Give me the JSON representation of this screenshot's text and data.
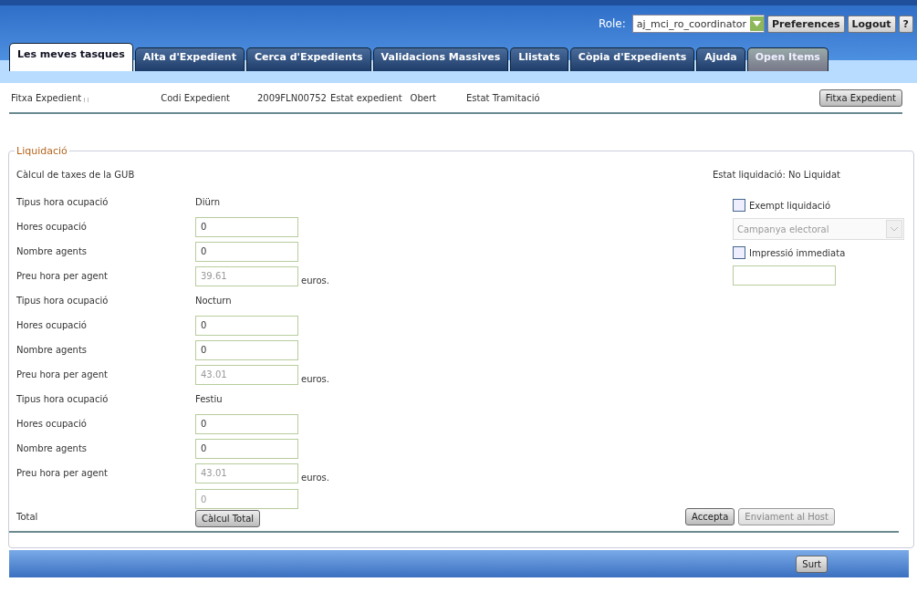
{
  "header": {
    "role_label": "Role:",
    "role_value": "aj_mci_ro_coordinator",
    "buttons": [
      "Preferences",
      "Logout",
      "?"
    ]
  },
  "tabs": [
    {
      "label": "Les meves tasques",
      "selected": true,
      "disabled": false
    },
    {
      "label": "Alta d'Expedient",
      "selected": false,
      "disabled": false
    },
    {
      "label": "Cerca d'Expedients",
      "selected": false,
      "disabled": false
    },
    {
      "label": "Validacions Massives",
      "selected": false,
      "disabled": false
    },
    {
      "label": "Llistats",
      "selected": false,
      "disabled": false
    },
    {
      "label": "Còpia d'Expedients",
      "selected": false,
      "disabled": false
    },
    {
      "label": "Ajuda",
      "selected": false,
      "disabled": false
    },
    {
      "label": "Open Items",
      "selected": false,
      "disabled": true
    }
  ],
  "info_bar": {
    "title": "Fitxa Expedient",
    "codi_label": "Codi Expedient",
    "codi_value": "2009FLN00752",
    "estat_label": "Estat expedient",
    "estat_value": "Obert",
    "tramitacio_label": "Estat Tramitació",
    "button": "Fitxa Expedient"
  },
  "liquidacio": {
    "legend": "Liquidació",
    "subtitle": "Càlcul de taxes de la GUB",
    "status": "Estat liquidació: No Liquidat",
    "rows": [
      {
        "kind": "text",
        "label": "Tipus hora ocupació",
        "value": "Diürn"
      },
      {
        "kind": "input",
        "label": "Hores ocupació",
        "value": "0",
        "disabled": false
      },
      {
        "kind": "input",
        "label": "Nombre agents",
        "value": "0",
        "disabled": false
      },
      {
        "kind": "input",
        "label": "Preu hora per agent",
        "value": "39.61",
        "disabled": true,
        "unit": "euros."
      },
      {
        "kind": "text",
        "label": "Tipus hora ocupació",
        "value": "Nocturn"
      },
      {
        "kind": "input",
        "label": "Hores ocupació",
        "value": "0",
        "disabled": false
      },
      {
        "kind": "input",
        "label": "Nombre agents",
        "value": "0",
        "disabled": false
      },
      {
        "kind": "input",
        "label": "Preu hora per agent",
        "value": "43.01",
        "disabled": true,
        "unit": "euros."
      },
      {
        "kind": "text",
        "label": "Tipus hora ocupació",
        "value": "Festiu"
      },
      {
        "kind": "input",
        "label": "Hores ocupació",
        "value": "0",
        "disabled": false
      },
      {
        "kind": "input",
        "label": "Nombre agents",
        "value": "0",
        "disabled": false
      },
      {
        "kind": "input",
        "label": "Preu hora per agent",
        "value": "43.01",
        "disabled": true,
        "unit": "euros."
      }
    ],
    "total": {
      "label": "Total",
      "value": "0",
      "disabled": true,
      "button": "Càlcul Total"
    },
    "exempt": {
      "label": "Exempt liquidació",
      "checked": false
    },
    "campanya": {
      "value": "Campanya electoral",
      "disabled": true
    },
    "impressio": {
      "label": "Impressió immediata",
      "checked": false
    },
    "actions": [
      {
        "label": "Accepta",
        "disabled": false
      },
      {
        "label": "Enviament al Host",
        "disabled": true
      }
    ]
  },
  "footer": {
    "button": "Surt"
  }
}
